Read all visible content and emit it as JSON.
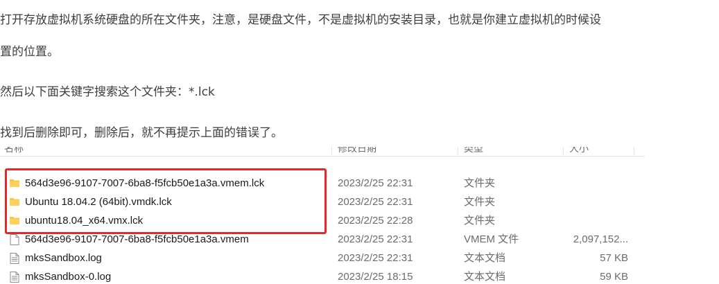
{
  "article": {
    "paragraph1_line1": "打开存放虚拟机系统硬盘的所在文件夹，注意，是硬盘文件，不是虚拟机的安装目录，也就是你建立虚拟机的时候设",
    "paragraph1_line2": "置的位置。",
    "paragraph2": "然后以下面关键字搜索这个文件夹：*.lck",
    "paragraph3": "找到后删除即可，删除后，就不再提示上面的错误了。"
  },
  "explorer": {
    "columns": {
      "name": "名称",
      "date": "修改日期",
      "type": "类型",
      "size": "大小"
    },
    "files": [
      {
        "name": "564d3e96-9107-7007-6ba8-f5fcb50e1a3a.vmem.lck",
        "date": "2023/2/25 22:31",
        "type": "文件夹",
        "size": "",
        "icon": "folder-icon"
      },
      {
        "name": "Ubuntu 18.04.2 (64bit).vmdk.lck",
        "date": "2023/2/25 22:31",
        "type": "文件夹",
        "size": "",
        "icon": "folder-icon"
      },
      {
        "name": "ubuntu18.04_x64.vmx.lck",
        "date": "2023/2/25 22:28",
        "type": "文件夹",
        "size": "",
        "icon": "folder-icon"
      },
      {
        "name": "564d3e96-9107-7007-6ba8-f5fcb50e1a3a.vmem",
        "date": "2023/2/25 22:31",
        "type": "VMEM 文件",
        "size": "2,097,152...",
        "icon": "file-icon"
      },
      {
        "name": "mksSandbox.log",
        "date": "2023/2/25 22:31",
        "type": "文本文档",
        "size": "57 KB",
        "icon": "text-file-icon"
      },
      {
        "name": "mksSandbox-0.log",
        "date": "2023/2/25 18:15",
        "type": "文本文档",
        "size": "59 KB",
        "icon": "text-file-icon"
      }
    ]
  },
  "colors": {
    "highlight": "#e8272a",
    "folder": "#f5c342"
  }
}
